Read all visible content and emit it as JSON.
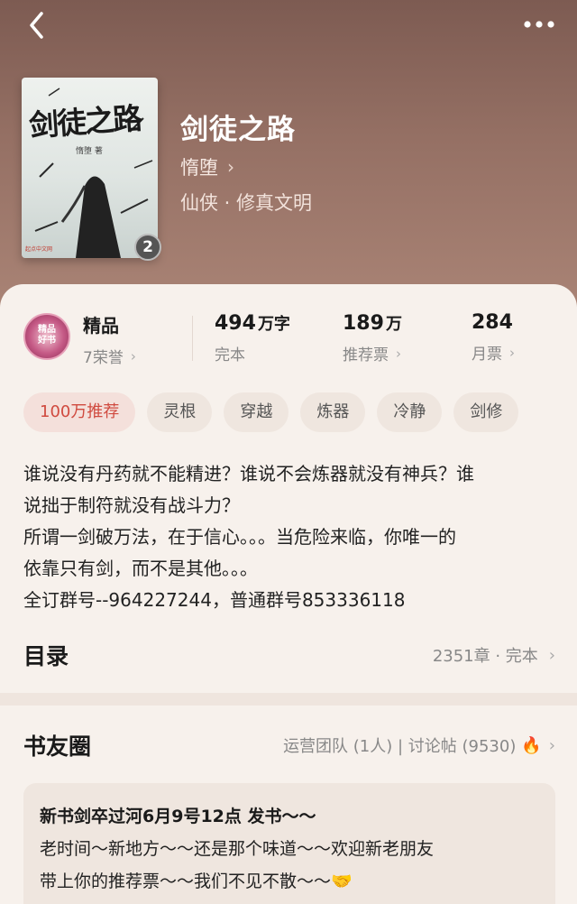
{
  "header": {
    "back_icon": "chevron-left-icon",
    "more_icon": "more-dots-icon"
  },
  "book": {
    "cover_title": "剑徒之路",
    "cover_author": "惰堕 著",
    "cover_publisher": "起点中文网",
    "cover_badge": "2",
    "title": "剑徒之路",
    "author": "惰堕",
    "genre": "仙侠 · 修真文明"
  },
  "stats": {
    "medal_label": "精品",
    "honor": "7荣誉",
    "word_count": "494",
    "word_unit": "万字",
    "status": "完本",
    "recommend_count": "189",
    "recommend_unit": "万",
    "recommend_label": "推荐票",
    "monthly_count": "284",
    "monthly_label": "月票"
  },
  "tags": [
    "100万推荐",
    "灵根",
    "穿越",
    "炼器",
    "冷静",
    "剑修"
  ],
  "description": [
    "谁说没有丹药就不能精进？谁说不会炼器就没有神兵？谁",
    "说拙于制符就没有战斗力？",
    "所谓一剑破万法，在于信心。。。当危险来临，你唯一的",
    "依靠只有剑，而不是其他。。。",
    "全订群号--964227244，普通群号853336118"
  ],
  "toc": {
    "title": "目录",
    "meta": "2351章 · 完本"
  },
  "circle": {
    "title": "书友圈",
    "meta": "运营团队 (1人) | 讨论帖 (9530)"
  },
  "post": {
    "title": "新书剑卒过河6月9号12点 发书～～",
    "lines": [
      "老时间～新地方～～还是那个味道～～欢迎新老朋友",
      "带上你的推荐票～～我们不见不散～～🤝"
    ]
  },
  "colors": {
    "accent": "#d04a3f",
    "hero_top": "#7d5b52",
    "hero_bottom": "#a98375"
  }
}
